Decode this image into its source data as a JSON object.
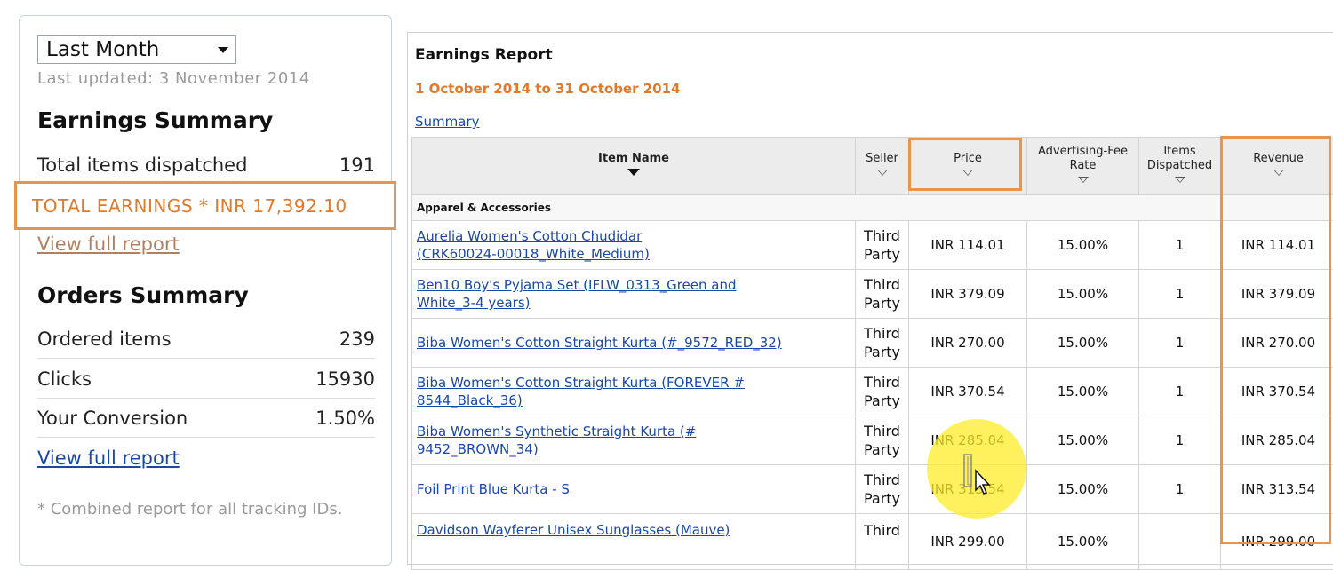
{
  "left": {
    "period": "Last Month",
    "last_updated": "Last updated: 3 November 2014",
    "earnings_title": "Earnings Summary",
    "items_dispatched_label": "Total items dispatched",
    "items_dispatched_value": "191",
    "total_earnings": "TOTAL EARNINGS * INR 17,392.10",
    "view_full_report": "View full report",
    "orders_title": "Orders Summary",
    "ordered_items_label": "Ordered items",
    "ordered_items_value": "239",
    "clicks_label": "Clicks",
    "clicks_value": "15930",
    "conversion_label": "Your Conversion",
    "conversion_value": "1.50%",
    "view_full_report_2": "View full report",
    "footnote": "* Combined report for all tracking IDs."
  },
  "report": {
    "title": "Earnings Report",
    "range": "1 October 2014 to 31 October 2014",
    "summary_link": "Summary",
    "columns": {
      "item_name": "Item Name",
      "seller": "Seller",
      "price": "Price",
      "ad_fee_1": "Advertising-Fee",
      "ad_fee_2": "Rate",
      "items_1": "Items",
      "items_2": "Dispatched",
      "revenue": "Revenue"
    },
    "category": "Apparel & Accessories",
    "rows": [
      {
        "name1": "Aurelia Women's Cotton Chudidar",
        "name2": "(CRK60024-00018_White_Medium)",
        "seller1": "Third",
        "seller2": "Party",
        "price": "INR 114.01",
        "rate": "15.00%",
        "qty": "1",
        "revenue": "INR 114.01"
      },
      {
        "name1": "Ben10 Boy's Pyjama Set (IFLW_0313_Green and",
        "name2": "White_3-4 years)",
        "seller1": "Third",
        "seller2": "Party",
        "price": "INR 379.09",
        "rate": "15.00%",
        "qty": "1",
        "revenue": "INR 379.09"
      },
      {
        "name1": "Biba Women's Cotton Straight Kurta (#_9572_RED_32)",
        "name2": "",
        "seller1": "Third",
        "seller2": "Party",
        "price": "INR 270.00",
        "rate": "15.00%",
        "qty": "1",
        "revenue": "INR 270.00"
      },
      {
        "name1": "Biba Women's Cotton Straight Kurta (FOREVER #",
        "name2": "8544_Black_36)",
        "seller1": "Third",
        "seller2": "Party",
        "price": "INR 370.54",
        "rate": "15.00%",
        "qty": "1",
        "revenue": "INR 370.54"
      },
      {
        "name1": "Biba Women's Synthetic Straight Kurta (#",
        "name2": "9452_BROWN_34)",
        "seller1": "Third",
        "seller2": "Party",
        "price": "INR 285.04",
        "rate": "15.00%",
        "qty": "1",
        "revenue": "INR 285.04"
      },
      {
        "name1": " Foil Print Blue Kurta - S",
        "name2": "",
        "seller1": "Third",
        "seller2": "Party",
        "price": "INR 313.54",
        "rate": "15.00%",
        "qty": "1",
        "revenue": "INR 313.54"
      },
      {
        "name1": "Davidson Wayferer Unisex Sunglasses (Mauve)",
        "name2": "",
        "seller1": "Third",
        "seller2": "",
        "price": "INR 299.00",
        "rate": "15.00%",
        "qty": "",
        "revenue": "INR 299.00"
      }
    ]
  },
  "colors": {
    "highlight": "#e8944a",
    "link": "#1a48a8",
    "earnings_text": "#e07a2a",
    "cursor_halo": "#ffec28"
  }
}
